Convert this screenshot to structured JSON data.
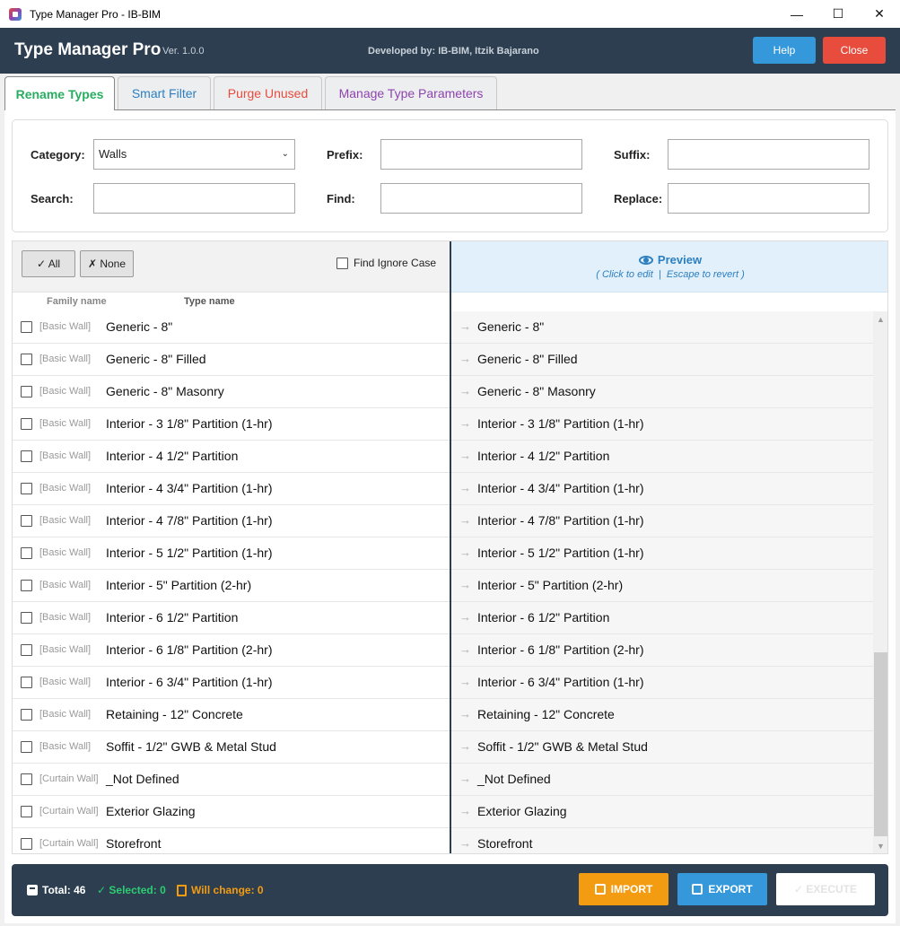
{
  "window": {
    "title": "Type Manager Pro - IB-BIM",
    "minimize": "—",
    "maximize": "☐",
    "close": "✕"
  },
  "header": {
    "brand": "Type Manager Pro",
    "version": "Ver. 1.0.0",
    "developer": "Developed by: IB-BIM, Itzik Bajarano",
    "help_label": "Help",
    "close_label": "Close"
  },
  "tabs": [
    {
      "label": "Rename Types",
      "active": true
    },
    {
      "label": "Smart Filter",
      "active": false
    },
    {
      "label": "Purge Unused",
      "active": false
    },
    {
      "label": "Manage Type Parameters",
      "active": false
    }
  ],
  "form": {
    "category_label": "Category:",
    "category_value": "Walls",
    "prefix_label": "Prefix:",
    "prefix_value": "",
    "suffix_label": "Suffix:",
    "suffix_value": "",
    "search_label": "Search:",
    "search_value": "",
    "find_label": "Find:",
    "find_value": "",
    "replace_label": "Replace:",
    "replace_value": ""
  },
  "list": {
    "all_label": "✓ All",
    "none_label": "✗ None",
    "ignore_case_label": "Find Ignore Case",
    "col_family": "Family name",
    "col_type": "Type name",
    "preview_title": "Preview",
    "preview_sub_a": "( Click to edit",
    "preview_sep": "|",
    "preview_sub_b": "Escape to revert )",
    "rows": [
      {
        "family": "[Basic Wall]",
        "type": "Generic - 8\"",
        "preview": "Generic - 8\""
      },
      {
        "family": "[Basic Wall]",
        "type": "Generic - 8\" Filled",
        "preview": "Generic - 8\" Filled"
      },
      {
        "family": "[Basic Wall]",
        "type": "Generic - 8\" Masonry",
        "preview": "Generic - 8\" Masonry"
      },
      {
        "family": "[Basic Wall]",
        "type": "Interior - 3 1/8\" Partition (1-hr)",
        "preview": "Interior - 3 1/8\" Partition (1-hr)"
      },
      {
        "family": "[Basic Wall]",
        "type": "Interior - 4 1/2\" Partition",
        "preview": "Interior - 4 1/2\" Partition"
      },
      {
        "family": "[Basic Wall]",
        "type": "Interior - 4 3/4\" Partition (1-hr)",
        "preview": "Interior - 4 3/4\" Partition (1-hr)"
      },
      {
        "family": "[Basic Wall]",
        "type": "Interior - 4 7/8\" Partition (1-hr)",
        "preview": "Interior - 4 7/8\" Partition (1-hr)"
      },
      {
        "family": "[Basic Wall]",
        "type": "Interior - 5 1/2\" Partition (1-hr)",
        "preview": "Interior - 5 1/2\" Partition (1-hr)"
      },
      {
        "family": "[Basic Wall]",
        "type": "Interior - 5\" Partition (2-hr)",
        "preview": "Interior - 5\" Partition (2-hr)"
      },
      {
        "family": "[Basic Wall]",
        "type": "Interior - 6 1/2\" Partition",
        "preview": "Interior - 6 1/2\" Partition"
      },
      {
        "family": "[Basic Wall]",
        "type": "Interior - 6 1/8\" Partition (2-hr)",
        "preview": "Interior - 6 1/8\" Partition (2-hr)"
      },
      {
        "family": "[Basic Wall]",
        "type": "Interior - 6 3/4\" Partition (1-hr)",
        "preview": "Interior - 6 3/4\" Partition (1-hr)"
      },
      {
        "family": "[Basic Wall]",
        "type": "Retaining - 12\" Concrete",
        "preview": "Retaining - 12\" Concrete"
      },
      {
        "family": "[Basic Wall]",
        "type": "Soffit - 1/2\" GWB & Metal Stud",
        "preview": "Soffit - 1/2\" GWB & Metal Stud"
      },
      {
        "family": "[Curtain Wall]",
        "type": "_Not Defined",
        "preview": "_Not Defined"
      },
      {
        "family": "[Curtain Wall]",
        "type": "Exterior Glazing",
        "preview": "Exterior Glazing"
      },
      {
        "family": "[Curtain Wall]",
        "type": "Storefront",
        "preview": "Storefront"
      }
    ]
  },
  "footer": {
    "total": "Total: 46",
    "selected": "✓ Selected: 0",
    "will_change": "Will change: 0",
    "import_label": "IMPORT",
    "export_label": "EXPORT",
    "execute_label": "✓ EXECUTE"
  },
  "colors": {
    "header_bg": "#2c3e50",
    "accent_blue": "#3498db",
    "danger_red": "#e74c3c",
    "success_green": "#27ae60",
    "warning_orange": "#f39c12",
    "purple": "#8e44ad"
  }
}
